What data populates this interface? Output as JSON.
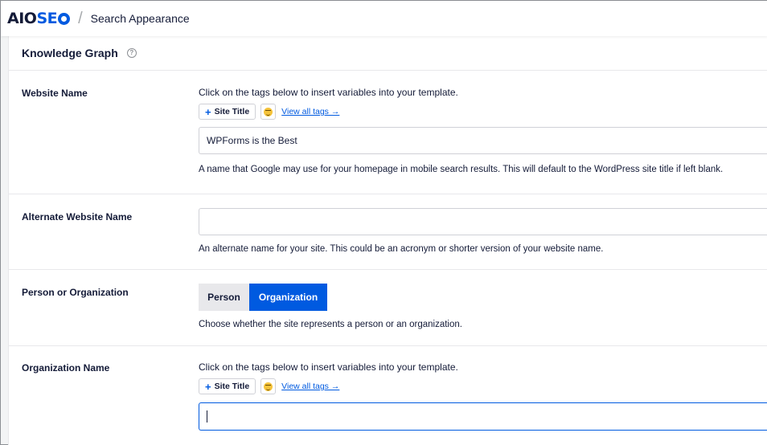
{
  "header": {
    "logo_prefix": "AIO",
    "logo_suffix": "SE",
    "separator": "/",
    "breadcrumb": "Search Appearance"
  },
  "card": {
    "title": "Knowledge Graph",
    "help_glyph": "?"
  },
  "website_name": {
    "label": "Website Name",
    "hint": "Click on the tags below to insert variables into your template.",
    "tag_button": "Site Title",
    "tag_plus": "+",
    "view_all": "View all tags →",
    "value": "WPForms is the Best",
    "description": "A name that Google may use for your homepage in mobile search results. This will default to the WordPress site title if left blank."
  },
  "alternate_name": {
    "label": "Alternate Website Name",
    "value": "",
    "description": "An alternate name for your site. This could be an acronym or shorter version of your website name."
  },
  "person_or_org": {
    "label": "Person or Organization",
    "options": [
      "Person",
      "Organization"
    ],
    "selected": "Organization",
    "description": "Choose whether the site represents a person or an organization."
  },
  "organization_name": {
    "label": "Organization Name",
    "hint": "Click on the tags below to insert variables into your template.",
    "tag_button": "Site Title",
    "tag_plus": "+",
    "view_all": "View all tags →",
    "value": ""
  },
  "colors": {
    "accent": "#005ae0",
    "text": "#141b38",
    "border": "#d0d1d7",
    "toggle_off": "#e8e8eb"
  },
  "icons": {
    "logo_gear": "gear-icon",
    "help": "help-circle-icon",
    "emoji": "emoji-icon",
    "plus": "plus-icon"
  }
}
